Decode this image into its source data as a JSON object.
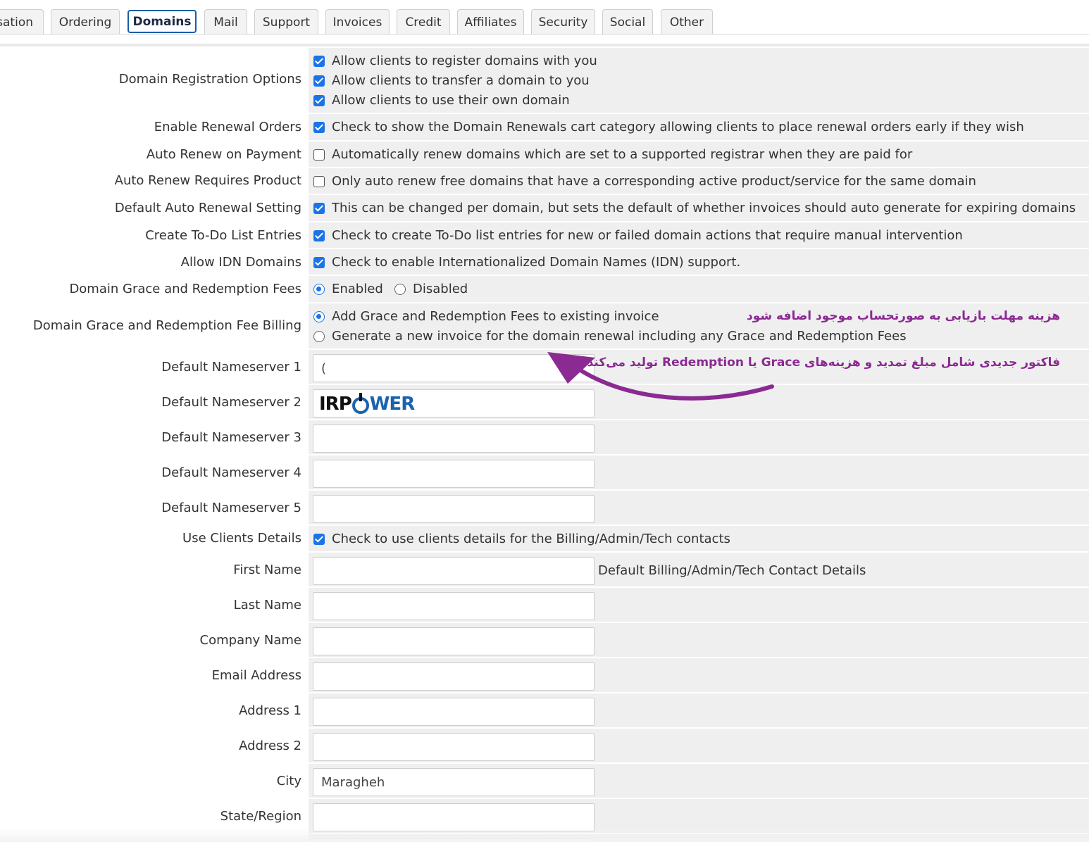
{
  "tabs": [
    {
      "label": "sation",
      "active": false
    },
    {
      "label": "Ordering",
      "active": false
    },
    {
      "label": "Domains",
      "active": true
    },
    {
      "label": "Mail",
      "active": false
    },
    {
      "label": "Support",
      "active": false
    },
    {
      "label": "Invoices",
      "active": false
    },
    {
      "label": "Credit",
      "active": false
    },
    {
      "label": "Affiliates",
      "active": false
    },
    {
      "label": "Security",
      "active": false
    },
    {
      "label": "Social",
      "active": false
    },
    {
      "label": "Other",
      "active": false
    }
  ],
  "settings": {
    "registration_options": {
      "label": "Domain Registration Options",
      "options": [
        {
          "text": "Allow clients to register domains with you",
          "checked": true
        },
        {
          "text": "Allow clients to transfer a domain to you",
          "checked": true
        },
        {
          "text": "Allow clients to use their own domain",
          "checked": true
        }
      ]
    },
    "renewal_orders": {
      "label": "Enable Renewal Orders",
      "text": "Check to show the Domain Renewals cart category allowing clients to place renewal orders early if they wish",
      "checked": true
    },
    "auto_renew_payment": {
      "label": "Auto Renew on Payment",
      "text": "Automatically renew domains which are set to a supported registrar when they are paid for",
      "checked": false
    },
    "auto_renew_product": {
      "label": "Auto Renew Requires Product",
      "text": "Only auto renew free domains that have a corresponding active product/service for the same domain",
      "checked": false
    },
    "default_auto_renewal": {
      "label": "Default Auto Renewal Setting",
      "text": "This can be changed per domain, but sets the default of whether invoices should auto generate for expiring domains",
      "checked": true
    },
    "todo_entries": {
      "label": "Create To-Do List Entries",
      "text": "Check to create To-Do list entries for new or failed domain actions that require manual intervention",
      "checked": true
    },
    "idn_domains": {
      "label": "Allow IDN Domains",
      "text": "Check to enable Internationalized Domain Names (IDN) support.",
      "checked": true
    },
    "grace_fees": {
      "label": "Domain Grace and Redemption Fees",
      "enabled_label": "Enabled",
      "disabled_label": "Disabled",
      "selected": "Enabled"
    },
    "grace_billing": {
      "label": "Domain Grace and Redemption Fee Billing",
      "options": [
        {
          "text": "Add Grace and Redemption Fees to existing invoice",
          "selected": true
        },
        {
          "text": "Generate a new invoice for the domain renewal including any Grace and Redemption Fees",
          "selected": false
        }
      ]
    },
    "nameservers": [
      {
        "label": "Default Nameserver 1",
        "value": "("
      },
      {
        "label": "Default Nameserver 2",
        "value": ""
      },
      {
        "label": "Default Nameserver 3",
        "value": ""
      },
      {
        "label": "Default Nameserver 4",
        "value": ""
      },
      {
        "label": "Default Nameserver 5",
        "value": ""
      }
    ],
    "use_client_details": {
      "label": "Use Clients Details",
      "text": "Check to use clients details for the Billing/Admin/Tech contacts",
      "checked": true
    },
    "contact_hint": "Default Billing/Admin/Tech Contact Details",
    "contact_fields": [
      {
        "label": "First Name",
        "value": ""
      },
      {
        "label": "Last Name",
        "value": ""
      },
      {
        "label": "Company Name",
        "value": ""
      },
      {
        "label": "Email Address",
        "value": ""
      },
      {
        "label": "Address 1",
        "value": ""
      },
      {
        "label": "Address 2",
        "value": ""
      },
      {
        "label": "City",
        "value": "Maragheh"
      },
      {
        "label": "State/Region",
        "value": ""
      }
    ]
  },
  "annotations": {
    "line1": "هزینه مهلت بازیابی به صورتحساب موجود اضافه شود",
    "line2": "فاکتور جدیدی شامل مبلغ تمدید و هزینه‌های Grace یا Redemption تولید می‌کند",
    "color": "#8b2a92"
  },
  "watermark": {
    "part1": "IRP",
    "part2": "WER"
  },
  "colors": {
    "accent": "#1a74e8",
    "active_tab_border": "#1a5ea6",
    "field_bg": "#efefef"
  }
}
